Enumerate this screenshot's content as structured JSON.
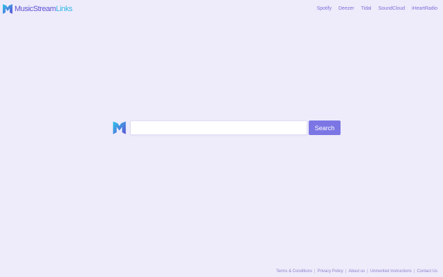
{
  "brand": {
    "name_main": "MusicStream",
    "name_tail": "Links",
    "logo_icon": "msl-logo-icon",
    "colors": {
      "primary": "#5c52d4",
      "secondary": "#2fb8e6"
    }
  },
  "nav": {
    "items": [
      {
        "label": "Spotify"
      },
      {
        "label": "Deezer"
      },
      {
        "label": "Tidal"
      },
      {
        "label": "SoundCloud"
      },
      {
        "label": "iHeartRadio"
      }
    ]
  },
  "search": {
    "input_value": "",
    "placeholder": "",
    "button_label": "Search",
    "button_color": "#7b76e4"
  },
  "footer": {
    "links": [
      {
        "label": "Terms & Conditions"
      },
      {
        "label": "Privacy Policy"
      },
      {
        "label": "About us"
      },
      {
        "label": "Unmerited Instructions"
      },
      {
        "label": "Contact Us"
      }
    ]
  },
  "colors": {
    "background": "#eeebfb"
  }
}
